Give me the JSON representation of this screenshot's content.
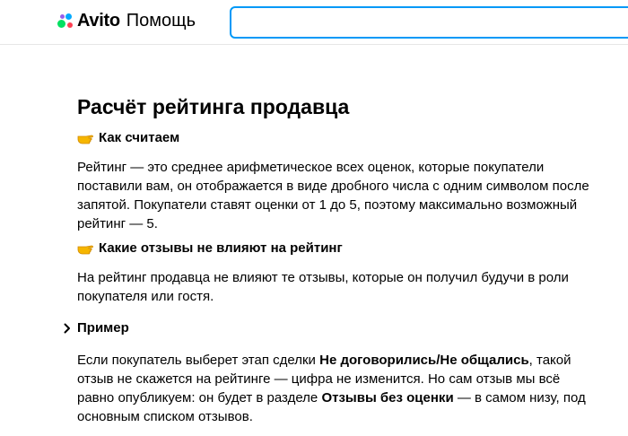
{
  "header": {
    "brand": "Avito",
    "section": "Помощь",
    "search": {
      "value": "",
      "placeholder": ""
    }
  },
  "article": {
    "title": "Расчёт рейтинга продавца",
    "sections": [
      {
        "heading": "Как считаем",
        "icon": "pointing-hand-icon",
        "text": "Рейтинг — это среднее арифметическое всех оценок, которые покупатели поставили вам, он отображается в виде дробного числа с одним символом после запятой. Покупатели ставят оценки от 1 до 5, поэтому максимально возможный рейтинг — 5."
      },
      {
        "heading": "Какие отзывы не влияют на рейтинг",
        "icon": "pointing-hand-icon",
        "text": "На рейтинг продавца не влияют те отзывы, которые он получил будучи в роли покупателя или гостя."
      }
    ],
    "example": {
      "label": "Пример",
      "icon": "chevron-right-icon",
      "text_1": "Если покупатель выберет этап сделки ",
      "bold_1": "Не договорились/Не общались",
      "text_2": ", такой отзыв не скажется на рейтинге — цифра не изменится. Но сам отзыв мы всё равно опубликуем: он будет в разделе ",
      "bold_2": "Отзывы без оценки",
      "text_3": " — в самом низу, под основным списком отзывов."
    }
  },
  "colors": {
    "search_border": "#0099f7",
    "hand": "#f6b600",
    "logo_green": "#04e061",
    "logo_blue": "#00aaff",
    "logo_red": "#ff4053",
    "logo_purple": "#965eeb"
  }
}
